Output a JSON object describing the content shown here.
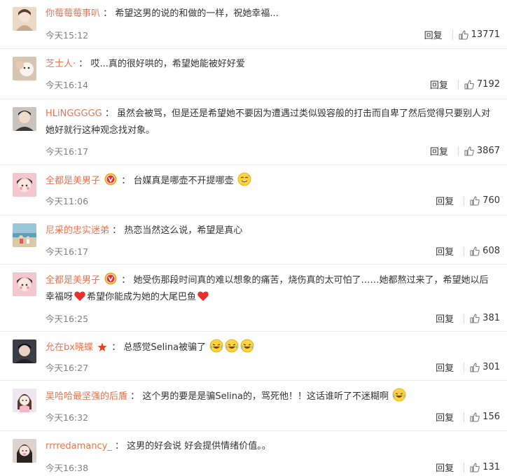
{
  "comments": [
    {
      "user": "你莓莓莓事叭",
      "sep": "：",
      "text": "希望这男的说的和做的一样，祝她幸福...",
      "time": "今天15:12",
      "reply": "回复",
      "likes": "13771",
      "avatar_color": "#e9d9c6"
    },
    {
      "user": "芝士人·",
      "sep": "：",
      "text": "哎...真的很好哄的，希望她能被好好爱",
      "time": "今天16:14",
      "reply": "回复",
      "likes": "7192",
      "avatar_color": "#d8c4b2"
    },
    {
      "user": "HLiNGGGGG",
      "sep": "：",
      "text": "虽然会被骂，但是还是希望她不要因为遭遇过类似毁容般的打击而自卑了然后觉得只要别人对她好就行这种观念找对象。",
      "time": "今天16:17",
      "reply": "回复",
      "likes": "3867",
      "avatar_color": "#c9c3bd"
    },
    {
      "user": "全都是美男子",
      "sep": "：",
      "text": "台媒真是哪壶不开提哪壶",
      "time": "今天11:06",
      "reply": "回复",
      "likes": "760",
      "avatar_color": "#f3c7cf",
      "emoji": "sweat-smile-emoji"
    },
    {
      "user": "尼采的忠实迷弟",
      "sep": "：",
      "text": "热恋当然这么说，希望是真心",
      "time": "今天16:17",
      "reply": "回复",
      "likes": "608",
      "avatar_color": "#9bc5d9"
    },
    {
      "user": "全都是美男子",
      "sep": "：",
      "text_a": "她受伤那段时间真的难以想象的痛苦，烧伤真的太可怕了……她都熬过来了，希望她以后幸福呀",
      "text_b": "希望你能成为她的大尾巴鱼",
      "time": "今天16:25",
      "reply": "回复",
      "likes": "381",
      "avatar_color": "#f3c7cf"
    },
    {
      "user": "允在bx晓蝶",
      "sep": "：",
      "text": "总感觉Selina被骗了",
      "time": "今天16:27",
      "reply": "回复",
      "likes": "301",
      "avatar_color": "#3d3d45"
    },
    {
      "user": "吴哈哈最坚强的后盾",
      "sep": "：",
      "text": "这个男的要是是骗Selina的，骂死他！！这话谁听了不迷糊啊",
      "time": "今天16:32",
      "reply": "回复",
      "likes": "156",
      "avatar_color": "#efe6f0"
    },
    {
      "user": "rrrredamancy_",
      "sep": "：",
      "text": "这男的好会说 好会提供情绪价值。。",
      "time": "今天16:38",
      "reply": "回复",
      "likes": "131",
      "avatar_color": "#ddd2cc"
    }
  ],
  "colors": {
    "username": "#eb7350",
    "text": "#333333",
    "time": "#808080",
    "heart": "#e8302a",
    "vip_badge": "#f7a21b"
  }
}
